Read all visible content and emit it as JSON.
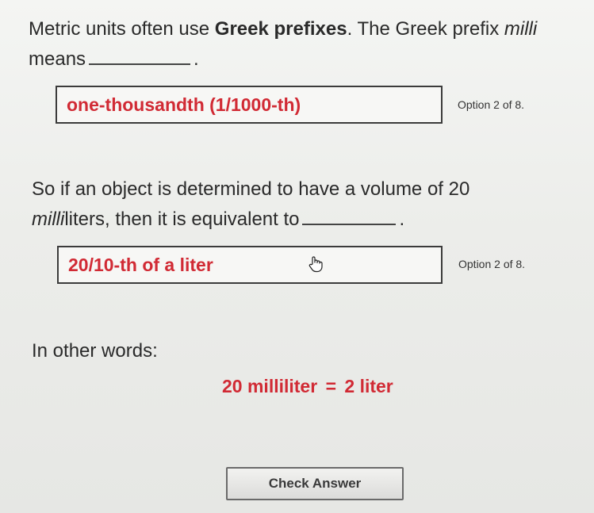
{
  "q1": {
    "text_a": "Metric units often use ",
    "bold": "Greek prefixes",
    "text_b": ". The Greek prefix ",
    "italic": "milli",
    "text_c": " means",
    "end": "."
  },
  "answer1": {
    "value": "one-thousandth (1/1000-th)",
    "option_label": "Option 2 of 8."
  },
  "q2": {
    "italic": "milli",
    "text_a": "So if an object is determined to have a volume of 20 ",
    "text_b": "liters, then it is equivalent to",
    "end": "."
  },
  "answer2": {
    "value": "20/10-th of a liter",
    "option_label": "Option 2 of 8."
  },
  "summary": {
    "intro": "In other words:",
    "left": "20 milliliter",
    "sign": "=",
    "right": "2 liter"
  },
  "check_button": {
    "label": "Check Answer"
  },
  "icons": {
    "cursor": "hand-pointer-icon"
  },
  "colors": {
    "accent_red": "#d12a34",
    "text": "#2a2a2a"
  }
}
